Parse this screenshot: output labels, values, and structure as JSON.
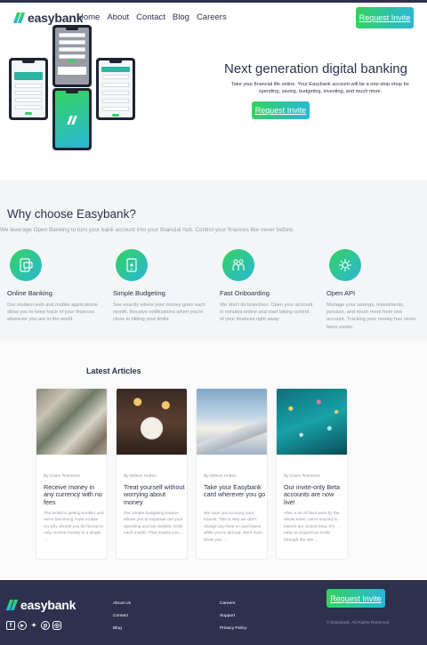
{
  "brand": {
    "name": "easybank",
    "accent_start": "#33d35e",
    "accent_end": "#2ab6d9",
    "dark": "#2d314d",
    "gray": "#9698a6"
  },
  "nav": {
    "items": [
      "Home",
      "About",
      "Contact",
      "Blog",
      "Careers"
    ],
    "cta": "Request Invite"
  },
  "hero": {
    "title": "Next generation digital banking",
    "text": "Take your financial life online. Your Easybank account will be a one-stop-shop for spending, saving, budgeting, investing, and much more.",
    "cta": "Request Invite"
  },
  "why": {
    "title": "Why choose Easybank?",
    "subtitle": "We leverage Open Banking to turn your bank account into your financial hub. Control your finances like never before.",
    "features": [
      {
        "icon": "online-banking-icon",
        "title": "Online Banking",
        "text": "Our modern web and mobile applications allow you to keep track of your finances wherever you are in the world."
      },
      {
        "icon": "budgeting-icon",
        "title": "Simple Budgeting",
        "text": "See exactly where your money goes each month. Receive notifications when you're close to hitting your limits."
      },
      {
        "icon": "onboarding-icon",
        "title": "Fast Onboarding",
        "text": "We don't do branches. Open your account in minutes online and start taking control of your finances right away."
      },
      {
        "icon": "api-icon",
        "title": "Open API",
        "text": "Manage your savings, investments, pension, and much more from one account. Tracking your money has never been easier."
      }
    ]
  },
  "articles": {
    "heading": "Latest Articles",
    "items": [
      {
        "image": "currency-photo",
        "author": "By Claire Robinson",
        "title": "Receive money in any currency with no fees",
        "excerpt": "The world is getting smaller and we're becoming more mobile. So why should you be forced to only receive money in a single ..."
      },
      {
        "image": "restaurant-photo",
        "author": "By Wilson Hutton",
        "title": "Treat yourself without worrying about money",
        "excerpt": "Our simple budgeting feature allows you to separate out your spending and set realistic limits each month. That means you ..."
      },
      {
        "image": "plane-photo",
        "author": "By Wilson Hutton",
        "title": "Take your Easybank card wherever you go",
        "excerpt": "We want you to enjoy your travels. This is why we don't charge any fees on purchases while you're abroad. We'll even show you ..."
      },
      {
        "image": "confetti-photo",
        "author": "By Claire Robinson",
        "title": "Our invite-only Beta accounts are now live!",
        "excerpt": "After a lot of hard work by the whole team, we're excited to launch our closed beta. It's easy to request an invite through the site ..."
      }
    ]
  },
  "footer": {
    "social": [
      "facebook-icon",
      "youtube-icon",
      "twitter-icon",
      "pinterest-icon",
      "instagram-icon"
    ],
    "col1": [
      "About Us",
      "Contact",
      "Blog"
    ],
    "col2": [
      "Careers",
      "Support",
      "Privacy Policy"
    ],
    "cta": "Request Invite",
    "copyright": "© Easybank. All Rights Reserved"
  }
}
